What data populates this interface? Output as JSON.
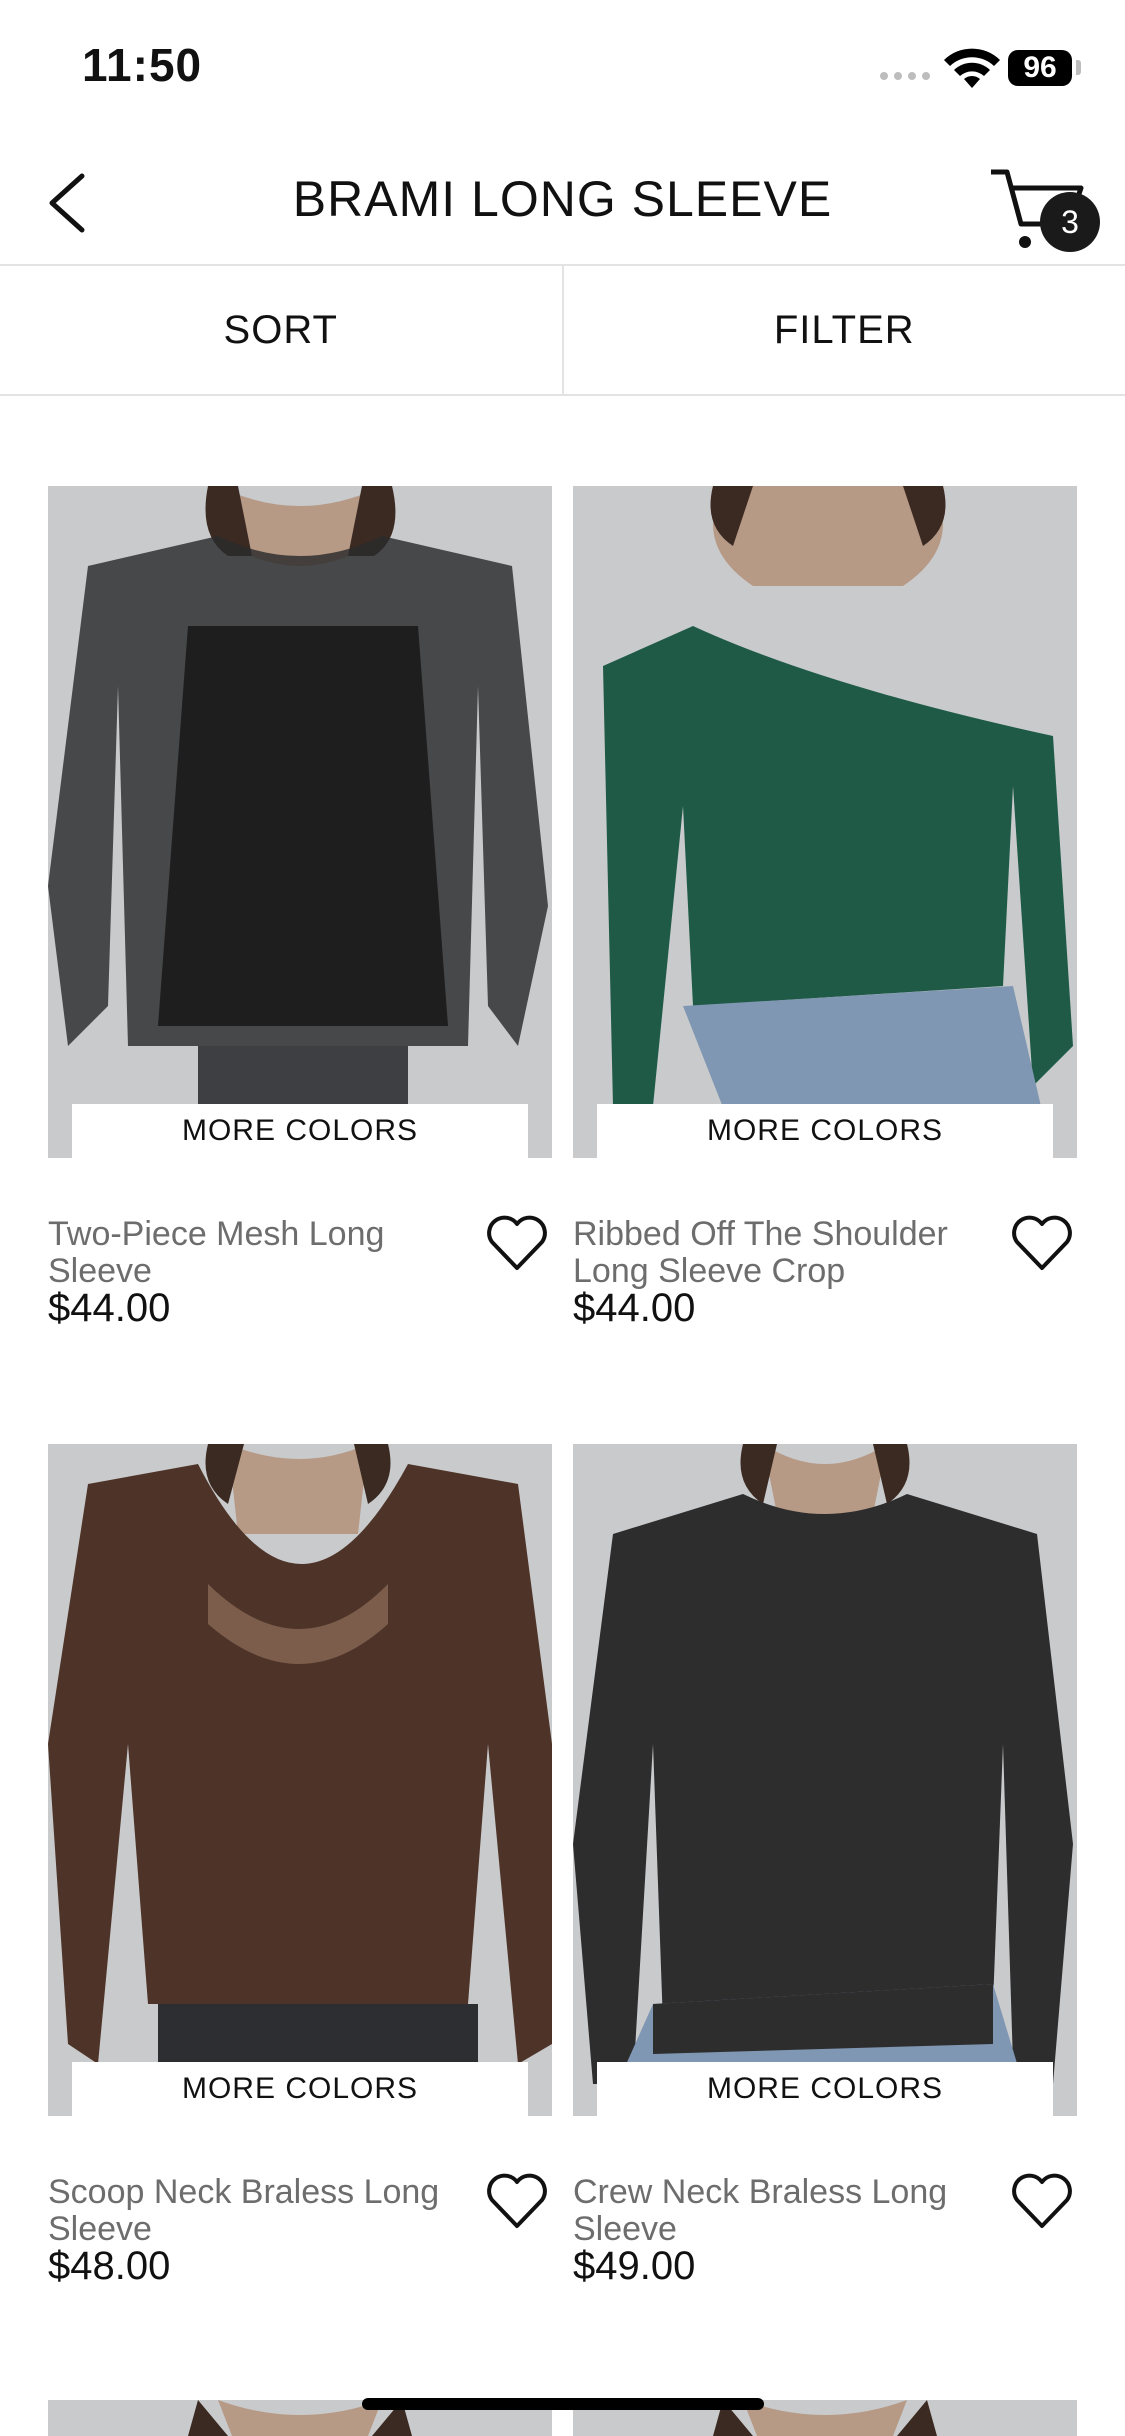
{
  "status": {
    "time": "11:50",
    "battery": "96"
  },
  "header": {
    "title": "BRAMI LONG SLEEVE",
    "cart_count": "3"
  },
  "toolbar": {
    "sort_label": "SORT",
    "filter_label": "FILTER"
  },
  "products": [
    {
      "name": "Two-Piece Mesh Long Sleeve",
      "price": "$44.00",
      "badge": "MORE COLORS",
      "color": "#2b2b2c"
    },
    {
      "name": "Ribbed Off The Shoulder Long Sleeve Crop",
      "price": "$44.00",
      "badge": "MORE COLORS",
      "color": "#1f5a47"
    },
    {
      "name": "Scoop Neck Braless Long Sleeve",
      "price": "$48.00",
      "badge": "MORE COLORS",
      "color": "#4e3428"
    },
    {
      "name": "Crew Neck Braless Long Sleeve",
      "price": "$49.00",
      "badge": "MORE COLORS",
      "color": "#2d2d2e"
    }
  ],
  "colors": {
    "accent": "#111111",
    "muted_text": "#6d6d6d",
    "divider": "#e3e3e3",
    "photo_bg": "#c8c9cb"
  }
}
